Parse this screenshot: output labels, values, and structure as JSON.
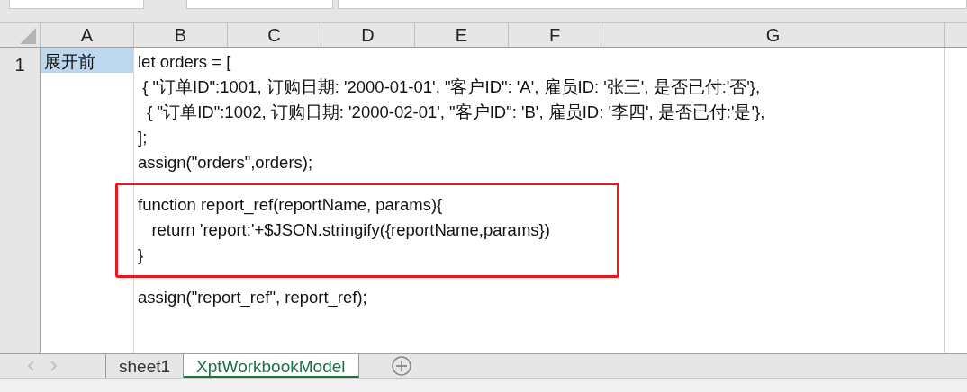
{
  "columns": [
    "A",
    "B",
    "C",
    "D",
    "E",
    "F",
    "G"
  ],
  "rows": [
    {
      "number": "1",
      "cell_a": {
        "text": "展开前",
        "selected": true
      },
      "cell_b": {
        "blocks": [
          {
            "highlighted": false,
            "lines": [
              "let orders = [",
              " { \"订单ID\":1001, 订购日期: '2000-01-01', \"客户ID\": 'A', 雇员ID: '张三', 是否已付:'否'},",
              "  { \"订单ID\":1002, 订购日期: '2000-02-01', \"客户ID\": 'B', 雇员ID: '李四', 是否已付:'是'},",
              "];",
              "assign(\"orders\",orders);"
            ]
          },
          {
            "highlighted": true,
            "lines": [
              "function report_ref(reportName, params){",
              "   return 'report:'+$JSON.stringify({reportName,params})",
              "}"
            ]
          },
          {
            "highlighted": false,
            "lines": [
              "assign(\"report_ref\", report_ref);"
            ]
          }
        ]
      }
    }
  ],
  "sheet_tabs": [
    {
      "label": "sheet1",
      "selected": false
    },
    {
      "label": "XptWorkbookModel",
      "selected": true
    }
  ]
}
